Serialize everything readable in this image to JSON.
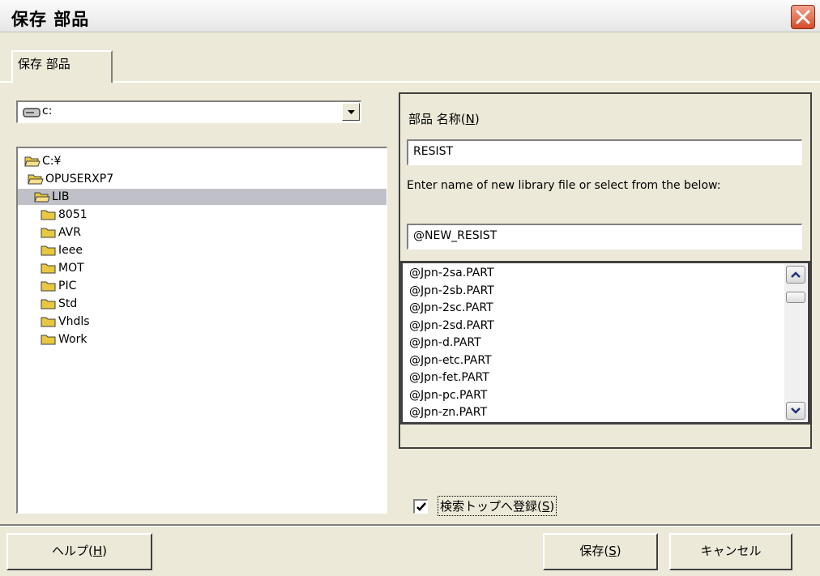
{
  "window": {
    "title": "保存 部品"
  },
  "tab": {
    "label": "保存 部品"
  },
  "drive": {
    "label": "c:"
  },
  "tree": [
    {
      "label": "C:¥",
      "open": true
    },
    {
      "label": "OPUSERXP7",
      "open": true
    },
    {
      "label": "LIB",
      "open": true,
      "selected": true
    },
    {
      "label": "8051"
    },
    {
      "label": "AVR"
    },
    {
      "label": "Ieee"
    },
    {
      "label": "MOT"
    },
    {
      "label": "PIC"
    },
    {
      "label": "Std"
    },
    {
      "label": "Vhdls"
    },
    {
      "label": "Work"
    }
  ],
  "part_name": {
    "label_text": "部品 名称(",
    "label_key": "N",
    "label_end": ")",
    "value": "RESIST"
  },
  "hint": "Enter name of new library file or select from the below:",
  "library_file": {
    "value": "@NEW_RESIST"
  },
  "library_list": [
    "@Jpn-2sa.PART",
    "@Jpn-2sb.PART",
    "@Jpn-2sc.PART",
    "@Jpn-2sd.PART",
    "@Jpn-d.PART",
    "@Jpn-etc.PART",
    "@Jpn-fet.PART",
    "@Jpn-pc.PART",
    "@Jpn-zn.PART"
  ],
  "register_checkbox": {
    "checked": true,
    "label_text": "検索トップへ登録(",
    "label_key": "S",
    "label_end": ")"
  },
  "buttons": {
    "help_text": "ヘルプ(",
    "help_key": "H",
    "help_end": ")",
    "save_text": "保存(",
    "save_key": "S",
    "save_end": ")",
    "cancel": "キャンセル"
  },
  "colors": {
    "close_button": "#d64a2a",
    "selection": "#c0c0c8",
    "folder": "#e8c840"
  }
}
